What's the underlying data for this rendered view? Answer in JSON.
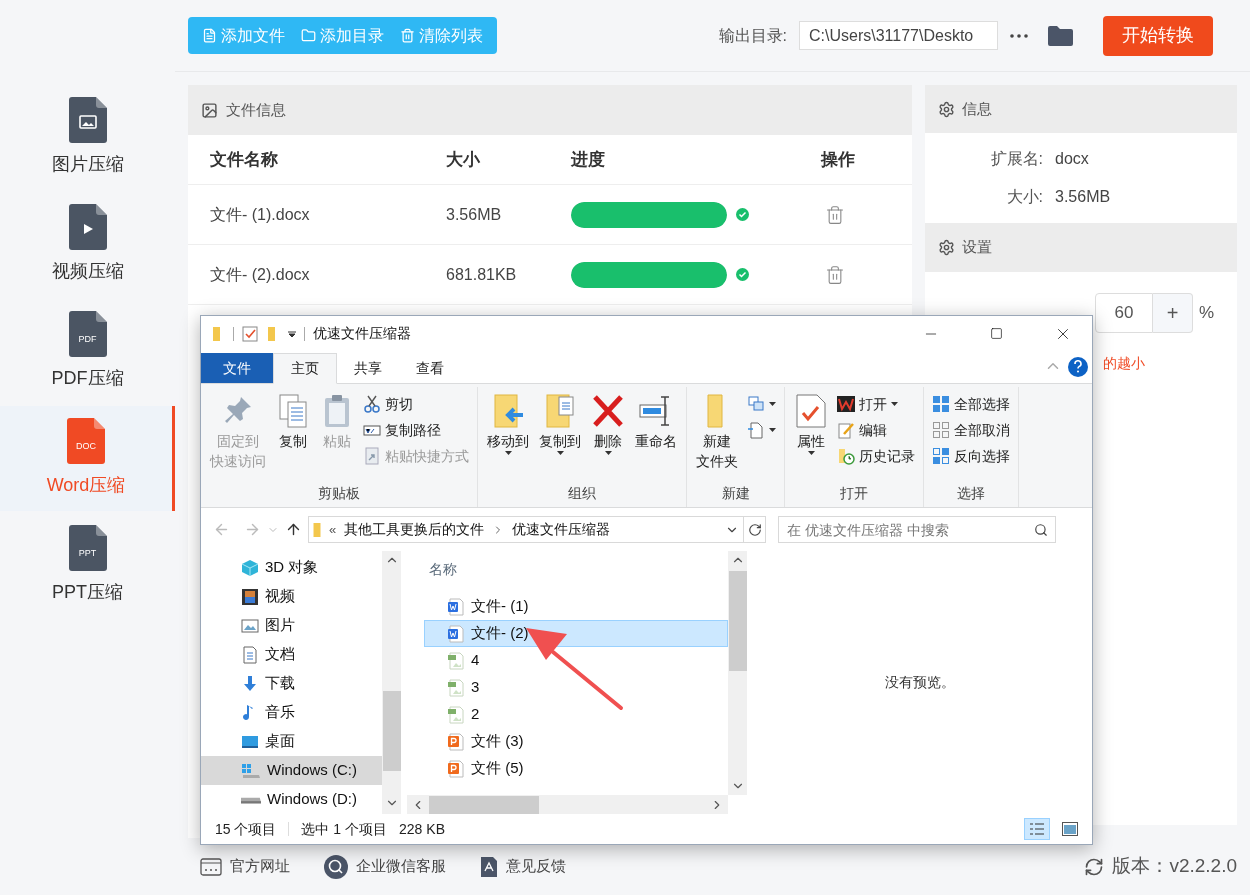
{
  "toolbar": {
    "buttons": [
      "添加文件",
      "添加目录",
      "清除列表"
    ],
    "output_label": "输出目录:",
    "output_path": "C:\\Users\\31177\\Deskto",
    "start_button": "开始转换"
  },
  "sidebar": {
    "items": [
      {
        "label": "图片压缩",
        "selected": false
      },
      {
        "label": "视频压缩",
        "selected": false
      },
      {
        "label": "PDF压缩",
        "badge": "PDF",
        "selected": false
      },
      {
        "label": "Word压缩",
        "badge": "DOC",
        "selected": true
      },
      {
        "label": "PPT压缩",
        "badge": "PPT",
        "selected": false
      }
    ]
  },
  "file_panel": {
    "title": "文件信息",
    "columns": [
      "文件名称",
      "大小",
      "进度",
      "操作"
    ],
    "rows": [
      {
        "name": "文件- (1).docx",
        "size": "3.56MB",
        "level": 1,
        "done": true
      },
      {
        "name": "文件- (2).docx",
        "size": "681.81KB",
        "level": 1,
        "done": true
      }
    ]
  },
  "info_panel": {
    "title": "信息",
    "fields": [
      {
        "label": "扩展名:",
        "value": "docx"
      },
      {
        "label": "大小:",
        "value": "3.56MB"
      }
    ]
  },
  "settings_panel": {
    "title": "设置",
    "value": "60",
    "plus": "+",
    "unit": "%",
    "hint": "的越小"
  },
  "footer": {
    "links": [
      "官方网址",
      "企业微信客服",
      "意见反馈"
    ],
    "version": "版本：v2.2.2.0"
  },
  "explorer": {
    "title": "优速文件压缩器",
    "tabs": [
      {
        "label": "文件",
        "kind": "menu",
        "selected": false
      },
      {
        "label": "主页",
        "kind": "tab",
        "selected": true
      },
      {
        "label": "共享",
        "kind": "tab",
        "selected": false
      },
      {
        "label": "查看",
        "kind": "tab",
        "selected": false
      }
    ],
    "groups": [
      {
        "label": "剪贴板",
        "items": [
          {
            "kind": "large",
            "lines": [
              "固定到",
              "快速访问"
            ],
            "disabled": true,
            "dropdown": false
          },
          {
            "kind": "large",
            "lines": [
              "复制"
            ],
            "disabled": false,
            "dropdown": false
          },
          {
            "kind": "large",
            "lines": [
              "粘贴"
            ],
            "disabled": true,
            "dropdown": false
          },
          {
            "kind": "small",
            "label": "剪切",
            "disabled": false,
            "dropdown": false
          },
          {
            "kind": "small",
            "label": "复制路径",
            "disabled": false,
            "dropdown": false
          },
          {
            "kind": "small",
            "label": "粘贴快捷方式",
            "disabled": true,
            "dropdown": false
          }
        ]
      },
      {
        "label": "组织",
        "items": [
          {
            "kind": "large",
            "lines": [
              "移动到"
            ],
            "disabled": false,
            "dropdown": true
          },
          {
            "kind": "large",
            "lines": [
              "复制到"
            ],
            "disabled": false,
            "dropdown": true
          },
          {
            "kind": "large",
            "lines": [
              "删除"
            ],
            "disabled": false,
            "dropdown": true
          },
          {
            "kind": "large",
            "lines": [
              "重命名"
            ],
            "disabled": false,
            "dropdown": false
          }
        ]
      },
      {
        "label": "新建",
        "items": [
          {
            "kind": "large",
            "lines": [
              "新建",
              "文件夹"
            ],
            "disabled": false,
            "dropdown": false
          },
          {
            "kind": "small",
            "disabled": false,
            "dropdown": true
          },
          {
            "kind": "small",
            "disabled": false,
            "dropdown": true
          }
        ]
      },
      {
        "label": "打开",
        "items": [
          {
            "kind": "large",
            "lines": [
              "属性"
            ],
            "disabled": false,
            "dropdown": true
          },
          {
            "kind": "small",
            "label": "打开",
            "disabled": false,
            "dropdown": true
          },
          {
            "kind": "small",
            "label": "编辑",
            "disabled": false,
            "dropdown": false
          },
          {
            "kind": "small",
            "label": "历史记录",
            "disabled": false,
            "dropdown": false
          }
        ]
      },
      {
        "label": "选择",
        "items": [
          {
            "kind": "small",
            "label": "全部选择",
            "disabled": false,
            "dropdown": false
          },
          {
            "kind": "small",
            "label": "全部取消",
            "disabled": false,
            "dropdown": false
          },
          {
            "kind": "small",
            "label": "反向选择",
            "disabled": false,
            "dropdown": false
          }
        ]
      }
    ],
    "path": {
      "overflow": "«",
      "crumbs": [
        "其他工具更换后的文件",
        "优速文件压缩器"
      ]
    },
    "search": {
      "placeholder": "在 优速文件压缩器 中搜索"
    },
    "nav": [
      {
        "label": "3D 对象",
        "selected": false
      },
      {
        "label": "视频",
        "selected": false
      },
      {
        "label": "图片",
        "selected": false
      },
      {
        "label": "文档",
        "selected": false
      },
      {
        "label": "下载",
        "selected": false
      },
      {
        "label": "音乐",
        "selected": false
      },
      {
        "label": "桌面",
        "selected": false
      },
      {
        "label": "Windows (C:)",
        "selected": true
      },
      {
        "label": "Windows (D:)",
        "selected": false
      }
    ],
    "column": "名称",
    "files": [
      {
        "name": "文件- (1)",
        "kind": "word",
        "selected": false
      },
      {
        "name": "文件- (2)",
        "kind": "word",
        "selected": true
      },
      {
        "name": "4",
        "kind": "png",
        "selected": false
      },
      {
        "name": "3",
        "kind": "png",
        "selected": false
      },
      {
        "name": "2",
        "kind": "png",
        "selected": false
      },
      {
        "name": "文件 (3)",
        "kind": "ppt",
        "selected": false
      },
      {
        "name": "文件 (5)",
        "kind": "ppt",
        "selected": false
      }
    ],
    "preview": "没有预览。",
    "status": {
      "count": "15 个项目",
      "selection": "选中 1 个项目",
      "size": "228 KB"
    }
  }
}
